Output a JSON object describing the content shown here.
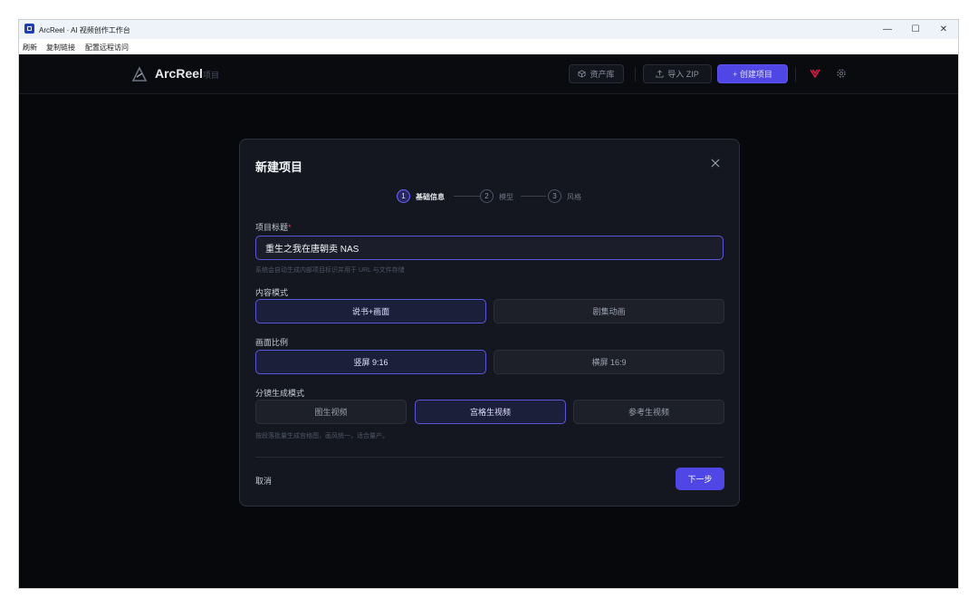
{
  "window": {
    "title": "ArcReel · AI 视频创作工作台",
    "controls": {
      "minimize": "—",
      "maximize": "☐",
      "close": "✕"
    }
  },
  "menubar": {
    "items": [
      "刷新",
      "复制链接",
      "配置远程访问"
    ]
  },
  "topbar": {
    "brand": "ArcReel",
    "brand_sub": "项目",
    "asset_library_label": "资产库",
    "import_zip_label": "导入 ZIP",
    "create_project_label": "+ 创建项目",
    "icons": [
      "cube-icon",
      "upload-icon",
      "logo-mark-icon",
      "gear-icon"
    ]
  },
  "modal": {
    "title": "新建项目",
    "steps": [
      {
        "number": "1",
        "label": "基础信息",
        "active": true
      },
      {
        "number": "2",
        "label": "模型",
        "active": false
      },
      {
        "number": "3",
        "label": "风格",
        "active": false
      }
    ],
    "project_title": {
      "label": "项目标题",
      "required_mark": "*",
      "value": "重生之我在唐朝卖 NAS",
      "hint": "系统会自动生成内部项目标识并用于 URL 与文件存储"
    },
    "content_mode": {
      "label": "内容模式",
      "options": [
        "说书+画面",
        "剧集动画"
      ],
      "selected": "说书+画面"
    },
    "aspect_ratio": {
      "label": "画面比例",
      "options": [
        "竖屏 9:16",
        "横屏 16:9"
      ],
      "selected": "竖屏 9:16"
    },
    "storyboard_mode": {
      "label": "分镜生成模式",
      "options": [
        "图生视频",
        "宫格生视频",
        "参考生视频"
      ],
      "selected": "宫格生视频",
      "hint": "按段落批量生成宫格图，画风统一，适合量产。"
    },
    "cancel_label": "取消",
    "next_label": "下一步"
  },
  "colors": {
    "accent": "#4f46e5",
    "selected_border": "#5b57d6",
    "background": "#0a0b0f",
    "modal_bg": "#141720",
    "required": "#f43f5e"
  }
}
